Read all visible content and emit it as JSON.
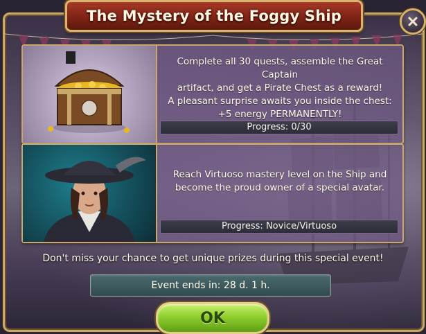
{
  "dialog": {
    "title": "The Mystery of the Foggy Ship",
    "close_icon": "close-x-icon"
  },
  "rewards": [
    {
      "image": "pirate-treasure-chest",
      "lines": [
        "Complete all 30 quests, assemble the Great Captain",
        "artifact, and get a Pirate Chest as a reward!",
        "A pleasant surprise awaits you inside the chest:",
        "+5 energy PERMANENTLY!"
      ],
      "progress": "Progress: 0/30"
    },
    {
      "image": "pirate-captain-avatar",
      "lines": [
        "Reach Virtuoso mastery level on the Ship and",
        "become the proud owner of a special avatar."
      ],
      "progress": "Progress: Novice/Virtuoso"
    }
  ],
  "footer": {
    "message": "Don't miss your chance to get unique prizes during this special event!",
    "event_ends": "Event ends in: 28 d. 1 h.",
    "ok_label": "OK"
  },
  "colors": {
    "title_banner": "#8a2a1a",
    "frame_gold": "#c9a86a",
    "ok_green": "#8fcf2e",
    "panel_purple": "#78608c"
  }
}
